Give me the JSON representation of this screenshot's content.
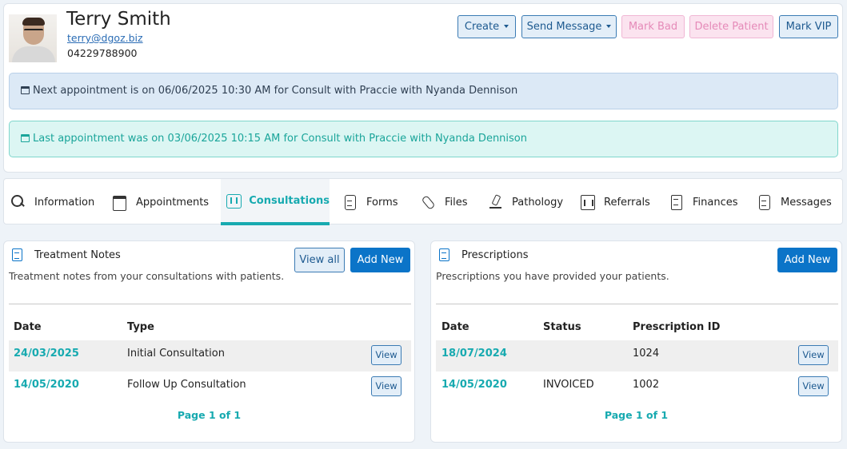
{
  "patient": {
    "name": "Terry Smith",
    "email": "terry@dgoz.biz",
    "phone": "04229788900"
  },
  "actions": {
    "create": "Create",
    "send_message": "Send Message",
    "mark_bad": "Mark Bad",
    "delete_patient": "Delete Patient",
    "mark_vip": "Mark VIP"
  },
  "appointments": {
    "next": "Next appointment is on 06/06/2025 10:30 AM for Consult with Praccie with Nyanda Dennison",
    "last": "Last appointment was on 03/06/2025 10:15 AM for Consult with Praccie with Nyanda Dennison"
  },
  "tabs": [
    {
      "label": "Information",
      "icon": "search-icon"
    },
    {
      "label": "Appointments",
      "icon": "calendar-icon"
    },
    {
      "label": "Consultations",
      "icon": "consultations-icon",
      "active": true
    },
    {
      "label": "Forms",
      "icon": "form-icon"
    },
    {
      "label": "Files",
      "icon": "paperclip-icon"
    },
    {
      "label": "Pathology",
      "icon": "microscope-icon"
    },
    {
      "label": "Referrals",
      "icon": "chart-icon"
    },
    {
      "label": "Finances",
      "icon": "receipt-icon"
    },
    {
      "label": "Messages",
      "icon": "message-icon"
    }
  ],
  "treatment_notes": {
    "title": "Treatment Notes",
    "subtitle": "Treatment notes from your consultations with patients.",
    "view_all": "View all",
    "add_new": "Add New",
    "columns": [
      "Date",
      "Type"
    ],
    "rows": [
      {
        "date": "24/03/2025",
        "type": "Initial Consultation",
        "action": "View"
      },
      {
        "date": "14/05/2020",
        "type": "Follow Up Consultation",
        "action": "View"
      }
    ],
    "pager": "Page 1 of 1"
  },
  "prescriptions": {
    "title": "Prescriptions",
    "subtitle": "Prescriptions you have provided your patients.",
    "add_new": "Add New",
    "columns": [
      "Date",
      "Status",
      "Prescription ID"
    ],
    "rows": [
      {
        "date": "18/07/2024",
        "status": "",
        "id": "1024",
        "action": "View"
      },
      {
        "date": "14/05/2020",
        "status": "INVOICED",
        "id": "1002",
        "action": "View"
      }
    ],
    "pager": "Page 1 of 1"
  }
}
